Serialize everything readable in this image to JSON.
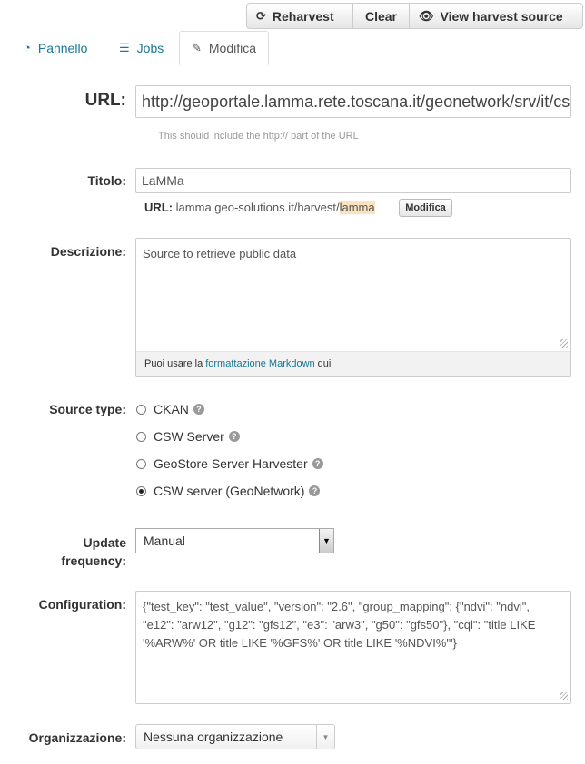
{
  "actions": {
    "reharvest": "Reharvest",
    "clear": "Clear",
    "view_source": "View harvest source"
  },
  "tabs": [
    {
      "label": "Pannello"
    },
    {
      "label": "Jobs"
    },
    {
      "label": "Modifica"
    }
  ],
  "url_field": {
    "label": "URL:",
    "value": "http://geoportale.lamma.rete.toscana.it/geonetwork/srv/it/csw",
    "hint": "This should include the http:// part of the URL"
  },
  "title_field": {
    "label": "Titolo:",
    "value": "LaMMa",
    "slug_label": "URL:",
    "slug_prefix": "lamma.geo-solutions.it/harvest/",
    "slug_value": "lamma",
    "edit_button": "Modifica"
  },
  "description_field": {
    "label": "Descrizione:",
    "value": "Source to retrieve public data",
    "md_prefix": "Puoi usare la",
    "md_link": "formattazione Markdown",
    "md_suffix": "qui"
  },
  "source_type": {
    "label": "Source type:",
    "options": [
      {
        "label": "CKAN",
        "checked": false
      },
      {
        "label": "CSW Server",
        "checked": false
      },
      {
        "label": "GeoStore Server Harvester",
        "checked": false
      },
      {
        "label": "CSW server (GeoNetwork)",
        "checked": true
      }
    ]
  },
  "update_frequency": {
    "label_line1": "Update",
    "label_line2": "frequency:",
    "value": "Manual"
  },
  "configuration": {
    "label": "Configuration:",
    "value": "{\"test_key\": \"test_value\", \"version\": \"2.6\", \"group_mapping\": {\"ndvi\": \"ndvi\", \"e12\": \"arw12\", \"g12\": \"gfs12\", \"e3\": \"arw3\", \"g50\": \"gfs50\"}, \"cql\": \"title LIKE '%ARW%' OR title LIKE '%GFS%' OR title LIKE '%NDVI%'\"}"
  },
  "organization": {
    "label": "Organizzazione:",
    "value": "Nessuna organizzazione"
  }
}
